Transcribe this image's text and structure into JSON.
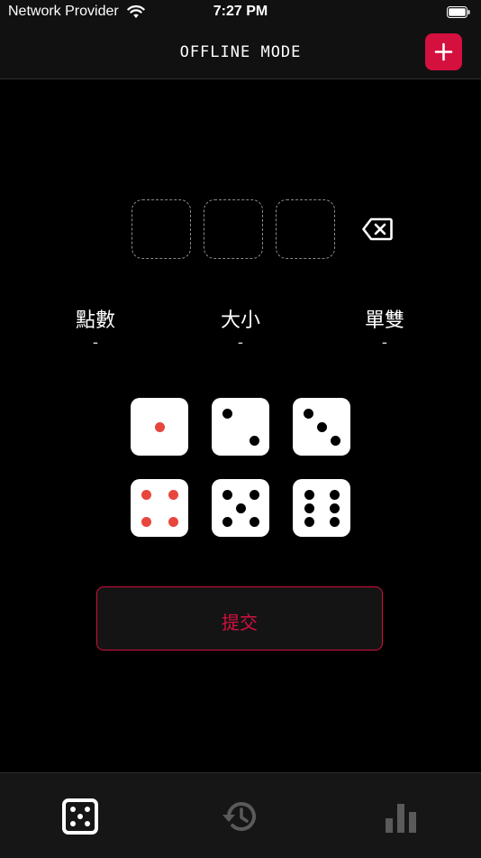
{
  "status_bar": {
    "carrier": "Network Provider",
    "time": "7:27 PM"
  },
  "header": {
    "title": "OFFLINE MODE",
    "add_icon": "plus-icon"
  },
  "input_slots": [
    "",
    "",
    ""
  ],
  "stats": [
    {
      "label": "點數",
      "value": "-"
    },
    {
      "label": "大小",
      "value": "-"
    },
    {
      "label": "單雙",
      "value": "-"
    }
  ],
  "dice": [
    {
      "face": 1,
      "pip_color": "#e8453c"
    },
    {
      "face": 2,
      "pip_color": "#000000"
    },
    {
      "face": 3,
      "pip_color": "#000000"
    },
    {
      "face": 4,
      "pip_color": "#e8453c"
    },
    {
      "face": 5,
      "pip_color": "#000000"
    },
    {
      "face": 6,
      "pip_color": "#000000"
    }
  ],
  "submit": {
    "label": "提交"
  },
  "tabs": [
    {
      "icon": "dice-icon",
      "active": true
    },
    {
      "icon": "history-icon",
      "active": false
    },
    {
      "icon": "bar-chart-icon",
      "active": false
    }
  ],
  "colors": {
    "accent": "#d4103f",
    "red_pip": "#e8453c",
    "inactive_tab": "#5a5a5a"
  }
}
